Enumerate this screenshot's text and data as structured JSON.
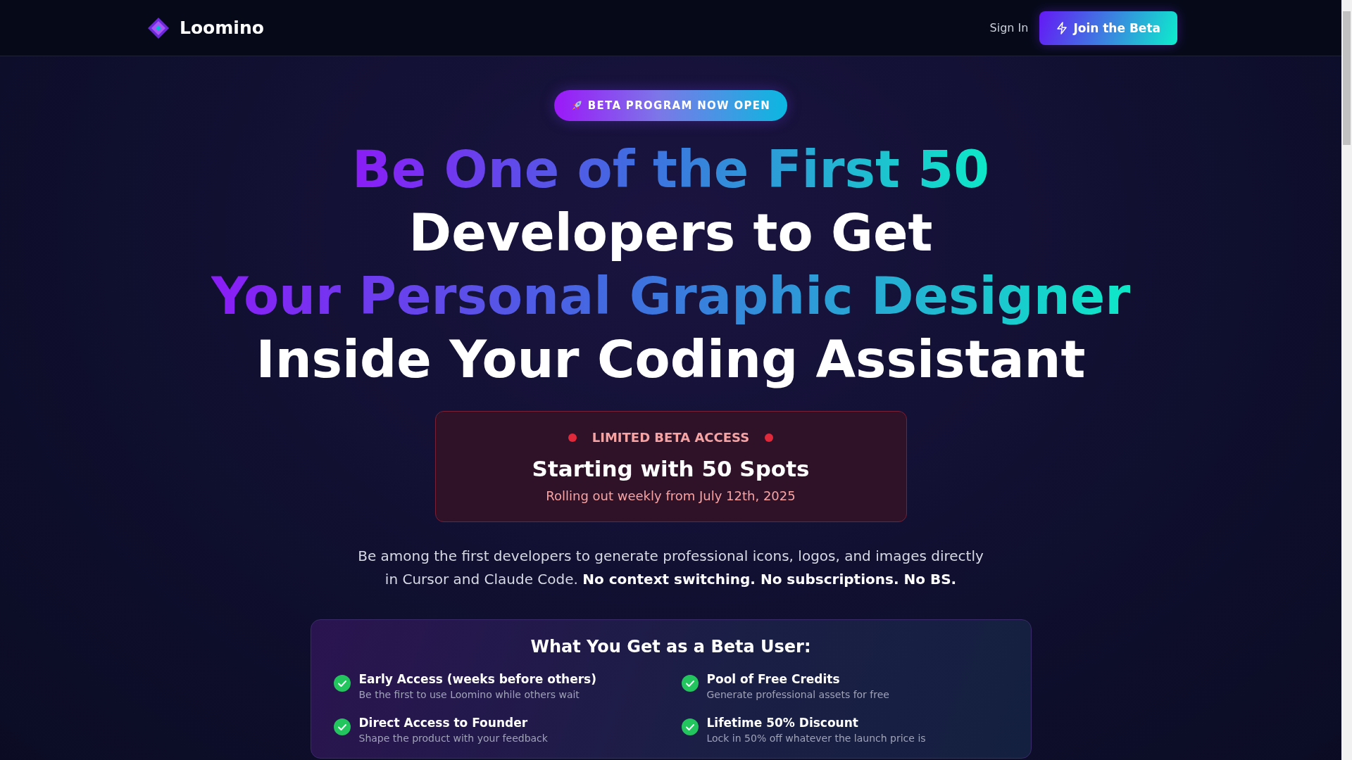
{
  "nav": {
    "brand": "Loomino",
    "sign_in": "Sign In",
    "cta": "Join the Beta"
  },
  "badge": {
    "label": "BETA PROGRAM NOW OPEN"
  },
  "headline": [
    {
      "text": "Be One of the First 50",
      "kind": "gradient"
    },
    {
      "text": "Developers to Get",
      "kind": "plain"
    },
    {
      "text": "Your Personal Graphic Designer",
      "kind": "gradient"
    },
    {
      "text": "Inside Your Coding Assistant",
      "kind": "plain"
    }
  ],
  "notice": {
    "label": "LIMITED BETA ACCESS",
    "title": "Starting with 50 Spots",
    "subtitle": "Rolling out weekly from July 12th, 2025"
  },
  "intro": "Be among the first developers to generate professional icons, logos, and images directly in Cursor and Claude Code. **No context switching. No subscriptions. No BS.**",
  "benefits": {
    "title": "What You Get as a Beta User:",
    "items": [
      {
        "title": "Early Access (weeks before others)",
        "text": "Be the first to use Loomino while others wait"
      },
      {
        "title": "Pool of Free Credits",
        "text": "Generate professional assets for free"
      },
      {
        "title": "Direct Access to Founder",
        "text": "Shape the product with your feedback"
      },
      {
        "title": "Lifetime 50% Discount",
        "text": "Lock in 50% off whatever the launch price is"
      }
    ]
  }
}
